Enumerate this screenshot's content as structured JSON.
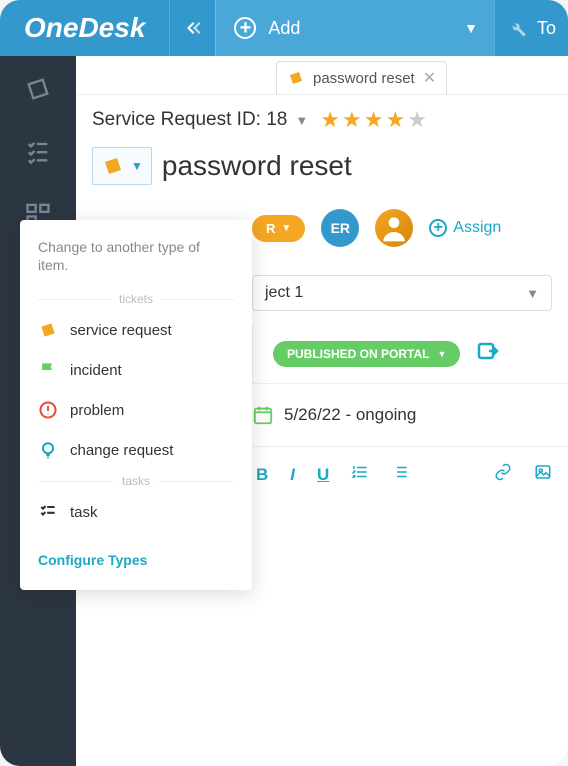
{
  "topbar": {
    "logo": "OneDesk",
    "add": "Add",
    "tools": "To"
  },
  "tab": {
    "label": "password reset"
  },
  "header": {
    "id_label": "Service Request ID: 18",
    "stars": 4
  },
  "item": {
    "title": "password reset"
  },
  "assignee": {
    "initials": "ER",
    "assign_label": "Assign"
  },
  "pill": {
    "text": "R"
  },
  "project": {
    "selected": "ject 1"
  },
  "portal": {
    "badge": "PUBLISHED ON PORTAL"
  },
  "date": {
    "text": "5/26/22 - ongoing"
  },
  "toolbar": {
    "bold": "B",
    "italic": "I",
    "underline": "U"
  },
  "dropdown": {
    "hint": "Change to another type of item.",
    "sec_tickets": "tickets",
    "sec_tasks": "tasks",
    "items": {
      "service_request": "service request",
      "incident": "incident",
      "problem": "problem",
      "change_request": "change request",
      "task": "task"
    },
    "configure": "Configure Types"
  }
}
